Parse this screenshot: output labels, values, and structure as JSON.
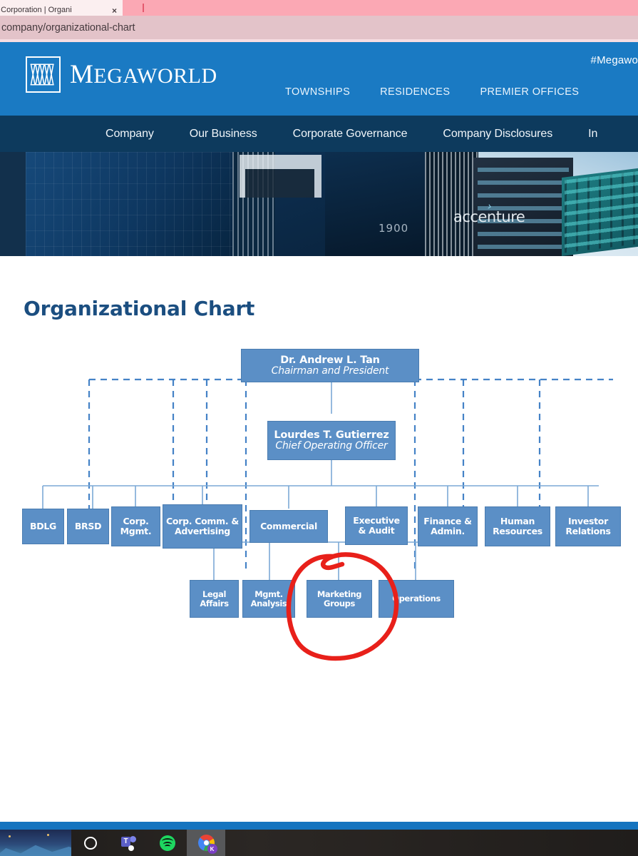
{
  "browser": {
    "tab_title": "d Corporation | Organi",
    "tab_close_glyph": "×",
    "url": "company/organizational-chart"
  },
  "site_header": {
    "logo_first_letter": "M",
    "logo_rest": "EGAWORLD",
    "hashtag": "#Megawo",
    "top_nav": [
      {
        "label": "TOWNSHIPS"
      },
      {
        "label": "RESIDENCES"
      },
      {
        "label": "PREMIER OFFICES"
      }
    ],
    "sub_nav": [
      {
        "label": "Company"
      },
      {
        "label": "Our Business"
      },
      {
        "label": "Corporate Governance"
      },
      {
        "label": "Company Disclosures"
      },
      {
        "label": "In"
      }
    ]
  },
  "hero": {
    "accenture_label": "accenture",
    "accenture_arrow": "›",
    "building_number": "1900"
  },
  "page": {
    "title": "Organizational Chart"
  },
  "chart_data": {
    "type": "diagram",
    "title": "Organizational Chart",
    "levels": [
      {
        "name": "executive",
        "nodes": [
          {
            "id": "chairman",
            "name": "Dr. Andrew L. Tan",
            "role": "Chairman and President"
          }
        ]
      },
      {
        "name": "coo",
        "nodes": [
          {
            "id": "coo",
            "name": "Lourdes T. Gutierrez",
            "role": "Chief Operating Officer"
          }
        ]
      },
      {
        "name": "departments",
        "nodes": [
          {
            "id": "bdlg",
            "label": "BDLG"
          },
          {
            "id": "brsd",
            "label": "BRSD"
          },
          {
            "id": "corp-mgmt",
            "label": "Corp. Mgmt."
          },
          {
            "id": "corp-comm",
            "label": "Corp. Comm. & Advertising"
          },
          {
            "id": "commercial",
            "label": "Commercial"
          },
          {
            "id": "exec-audit",
            "label": "Executive & Audit"
          },
          {
            "id": "finance-admin",
            "label": "Finance & Admin."
          },
          {
            "id": "human-resources",
            "label": "Human Resources"
          },
          {
            "id": "investor-relations",
            "label": "Investor Relations"
          }
        ]
      },
      {
        "name": "sub-departments",
        "nodes": [
          {
            "id": "legal-affairs",
            "label": "Legal Affairs"
          },
          {
            "id": "mgmt-analysis",
            "label": "Mgmt. Analysis"
          },
          {
            "id": "marketing-groups",
            "label": "Marketing Groups"
          },
          {
            "id": "operations",
            "label": "Operations"
          }
        ]
      }
    ],
    "colors": {
      "node_fill": "#5b8fc6",
      "node_border": "#4a7cb0",
      "node_text": "#ffffff",
      "connector": "#7ba9d6",
      "swimlane_dash": "#3b7cc4",
      "title": "#1b4e80",
      "annotation": "#e8201a"
    },
    "annotation": {
      "shape": "hand-drawn-circle",
      "color": "#e8201a",
      "targets": "marketing-groups"
    }
  },
  "taskbar": {
    "items": [
      {
        "name": "cortana",
        "label": "Cortana"
      },
      {
        "name": "teams",
        "label": "Microsoft Teams",
        "glyph": "T"
      },
      {
        "name": "spotify",
        "label": "Spotify"
      },
      {
        "name": "chrome",
        "label": "Google Chrome",
        "badge": "K"
      }
    ]
  }
}
